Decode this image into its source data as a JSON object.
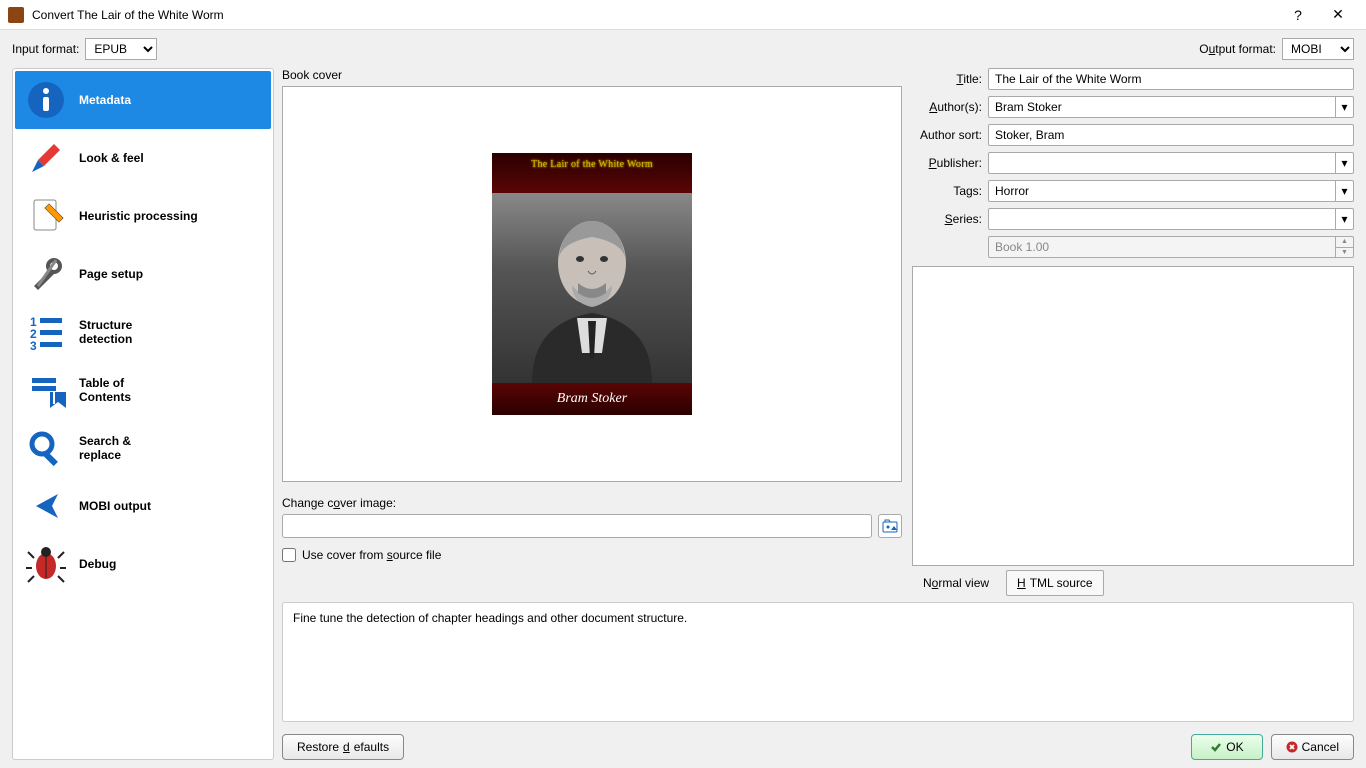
{
  "window": {
    "title": "Convert The Lair of the White Worm"
  },
  "format": {
    "input_label": "Input format:",
    "input_value": "EPUB",
    "output_label_pre": "O",
    "output_label_u": "u",
    "output_label_post": "tput format:",
    "output_value": "MOBI"
  },
  "sidebar": {
    "items": [
      {
        "label": "Metadata"
      },
      {
        "label": "Look & feel"
      },
      {
        "label": "Heuristic processing"
      },
      {
        "label": "Page setup"
      },
      {
        "label": "Structure detection"
      },
      {
        "label": "Table of Contents"
      },
      {
        "label": "Search & replace"
      },
      {
        "label": "MOBI output"
      },
      {
        "label": "Debug"
      }
    ]
  },
  "cover": {
    "section_label": "Book cover",
    "title_line": "The Lair of the White Worm",
    "author_line": "Bram Stoker",
    "change_label_pre": "Change c",
    "change_label_u": "o",
    "change_label_post": "ver image:",
    "checkbox_pre": "Use cover from ",
    "checkbox_u": "s",
    "checkbox_post": "ource file"
  },
  "meta": {
    "title_label_u": "T",
    "title_label_post": "itle:",
    "author_label_u": "A",
    "author_label_post": "uthor(s):",
    "authorsort_label": "Author sort:",
    "publisher_label_u": "P",
    "publisher_label_post": "ublisher:",
    "tags_label": "Tags:",
    "series_label_u": "S",
    "series_label_post": "eries:",
    "title": "The Lair of the White Worm",
    "author": "Bram Stoker",
    "authorsort": "Stoker, Bram",
    "publisher": "",
    "tags": "Horror",
    "series": "",
    "book_num": "Book 1.00"
  },
  "tabs": {
    "normal_pre": "N",
    "normal_u": "o",
    "normal_post": "rmal view",
    "html_u": "H",
    "html_post": "TML source"
  },
  "hint": "Fine tune the detection of chapter headings and other document structure.",
  "buttons": {
    "restore_pre": "Restore ",
    "restore_u": "d",
    "restore_post": "efaults",
    "ok": "OK",
    "cancel": "Cancel"
  }
}
